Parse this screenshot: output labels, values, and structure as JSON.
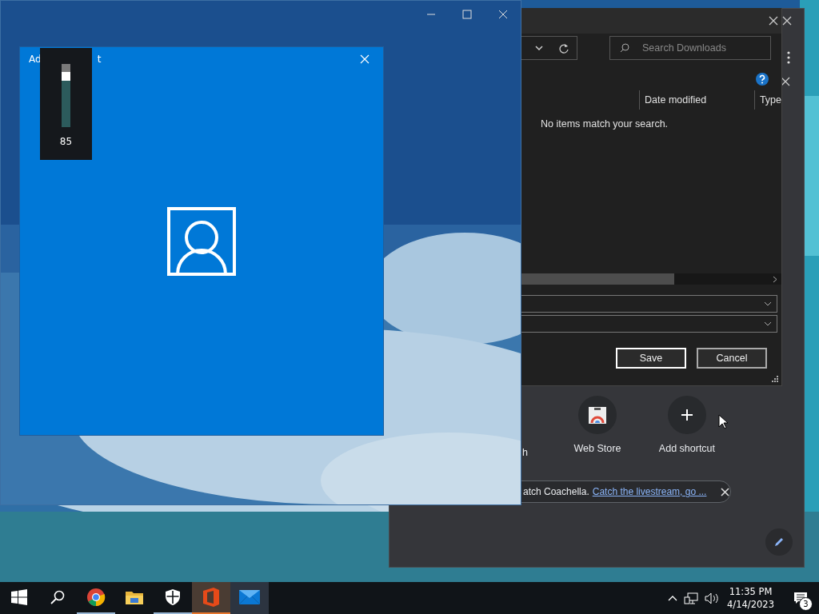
{
  "browser_window": {
    "shortcuts": [
      {
        "label": "h",
        "kind": "hidden"
      },
      {
        "label": "Web Store",
        "kind": "store"
      },
      {
        "label": "Add shortcut",
        "kind": "add"
      }
    ],
    "promo": {
      "text": "atch Coachella.",
      "link": "Catch the livestream, go ..."
    }
  },
  "save_dialog": {
    "search": {
      "placeholder": "Search Downloads"
    },
    "columns": [
      "Date modified",
      "Type"
    ],
    "empty_message": "No items match your search.",
    "buttons": [
      {
        "label": "Save",
        "default": true
      },
      {
        "label": "Cancel",
        "default": false
      }
    ]
  },
  "account_dialog": {
    "title_visible": [
      "Ad",
      "t"
    ]
  },
  "volume_flyout": {
    "reading": "85"
  },
  "taskbar": {
    "apps": [
      {
        "kind": "start",
        "running": false,
        "active": false,
        "hovered": false
      },
      {
        "kind": "search",
        "running": false,
        "active": false,
        "hovered": false
      },
      {
        "kind": "chrome",
        "running": true,
        "active": false,
        "hovered": false
      },
      {
        "kind": "explorer",
        "running": false,
        "active": false,
        "hovered": false
      },
      {
        "kind": "security",
        "running": true,
        "active": false,
        "hovered": false
      },
      {
        "kind": "office",
        "running": true,
        "active": true,
        "hovered": false
      },
      {
        "kind": "mail",
        "running": false,
        "active": false,
        "hovered": true
      }
    ],
    "time": "11:35 PM",
    "date": "4/14/2023",
    "notification_count": "3"
  }
}
